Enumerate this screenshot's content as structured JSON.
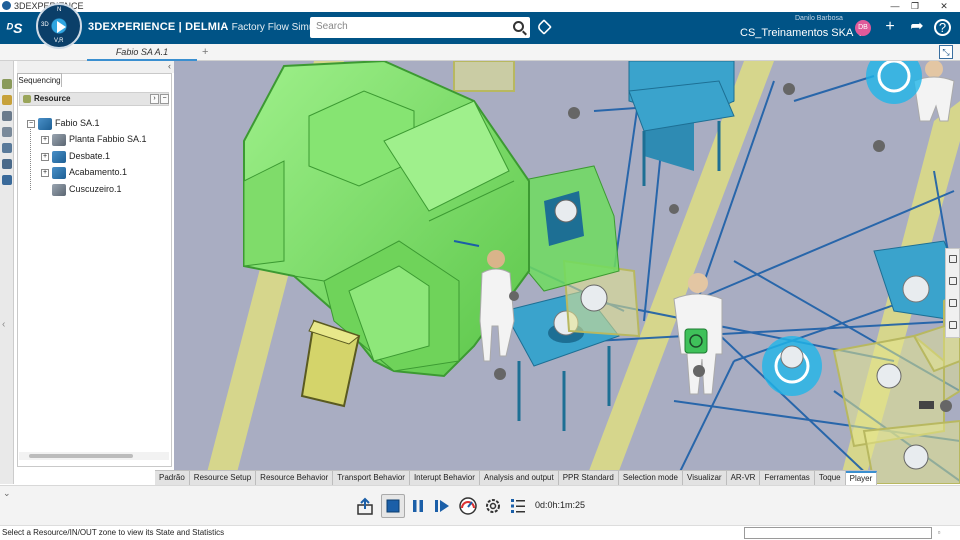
{
  "os": {
    "title": "3DEXPERIENCE"
  },
  "header": {
    "brand_main": "3DEXPERIENCE | DELMIA",
    "brand_sub": "Factory Flow Simulation",
    "search_placeholder": "Search",
    "user_name": "Danilo Barbosa",
    "tenant": "CS_Treinamentos SKA",
    "avatar_initials": "DB",
    "compass_3d": "3D",
    "compass_vr": "V,R",
    "compass_n": "N"
  },
  "tabs": {
    "active_label": "Fabio SA A.1",
    "add_label": "+"
  },
  "panel": {
    "tab_label": "Sequencing",
    "section_label": "Resource",
    "tree": [
      {
        "label": "Fabio SA.1",
        "expander": "−"
      },
      {
        "label": "Planta Fabbio SA.1",
        "expander": "+"
      },
      {
        "label": "Desbate.1",
        "expander": "+"
      },
      {
        "label": "Acabamento.1",
        "expander": "+"
      },
      {
        "label": "Cuscuzeiro.1",
        "expander": ""
      }
    ]
  },
  "workbench_tabs": [
    "Padrão",
    "Resource Setup",
    "Resource Behavior",
    "Transport Behavior",
    "Interupt Behavior",
    "Analysis and output",
    "PPR Standard",
    "Selection mode",
    "Visualizar",
    "AR-VR",
    "Ferramentas",
    "Toque",
    "Player"
  ],
  "active_workbench_tab": "Player",
  "player": {
    "timer": "0d:0h:1m:25"
  },
  "status": {
    "message": "Select a Resource/IN/OUT zone to view its State and Statistics"
  },
  "colors": {
    "header_bg": "#005386",
    "machine_green": "#7fd96a",
    "table_blue": "#3aa3cc",
    "floor": "#a9adc2",
    "lane_yellow": "#d9d98a",
    "flow_line": "#1b5fa8",
    "accent": "#3a8fd0"
  },
  "icons": {
    "toolbar": [
      "export-icon",
      "stop-icon",
      "pause-icon",
      "step-forward-icon",
      "speed-gauge-icon",
      "settings-icon",
      "list-icon"
    ]
  }
}
